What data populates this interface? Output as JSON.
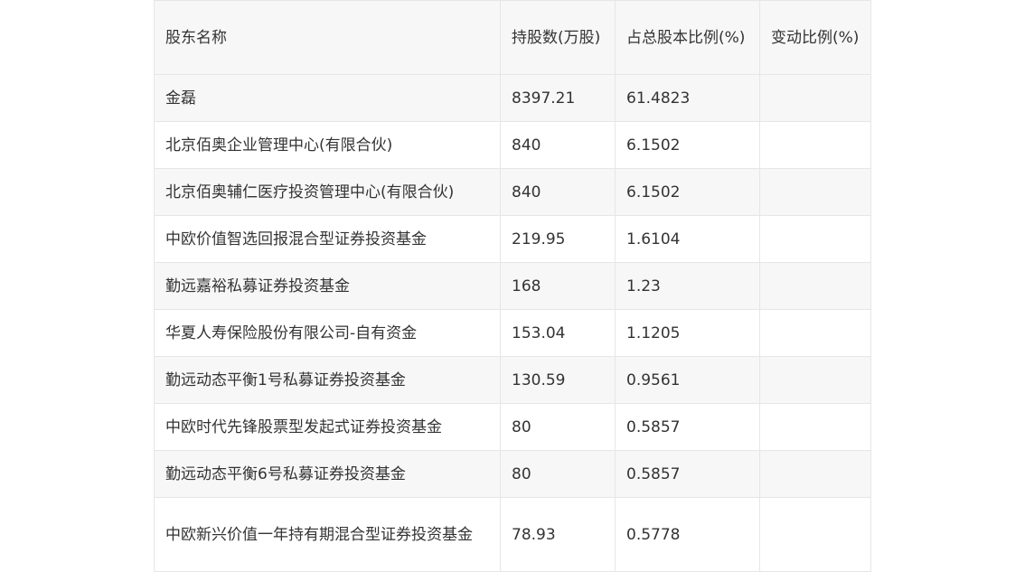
{
  "table": {
    "headers": [
      "股东名称",
      "持股数(万股)",
      "占总股本比例(%)",
      "变动比例(%)"
    ],
    "rows": [
      {
        "name": "金磊",
        "shares": "8397.21",
        "ratio": "61.4823",
        "change": ""
      },
      {
        "name": "北京佰奥企业管理中心(有限合伙)",
        "shares": "840",
        "ratio": "6.1502",
        "change": ""
      },
      {
        "name": "北京佰奥辅仁医疗投资管理中心(有限合伙)",
        "shares": "840",
        "ratio": "6.1502",
        "change": ""
      },
      {
        "name": "中欧价值智选回报混合型证券投资基金",
        "shares": "219.95",
        "ratio": "1.6104",
        "change": ""
      },
      {
        "name": "勤远嘉裕私募证券投资基金",
        "shares": "168",
        "ratio": "1.23",
        "change": ""
      },
      {
        "name": "华夏人寿保险股份有限公司-自有资金",
        "shares": "153.04",
        "ratio": "1.1205",
        "change": ""
      },
      {
        "name": "勤远动态平衡1号私募证券投资基金",
        "shares": "130.59",
        "ratio": "0.9561",
        "change": ""
      },
      {
        "name": "中欧时代先锋股票型发起式证券投资基金",
        "shares": "80",
        "ratio": "0.5857",
        "change": ""
      },
      {
        "name": "勤远动态平衡6号私募证券投资基金",
        "shares": "80",
        "ratio": "0.5857",
        "change": ""
      },
      {
        "name": "中欧新兴价值一年持有期混合型证券投资基金",
        "shares": "78.93",
        "ratio": "0.5778",
        "change": ""
      }
    ]
  }
}
